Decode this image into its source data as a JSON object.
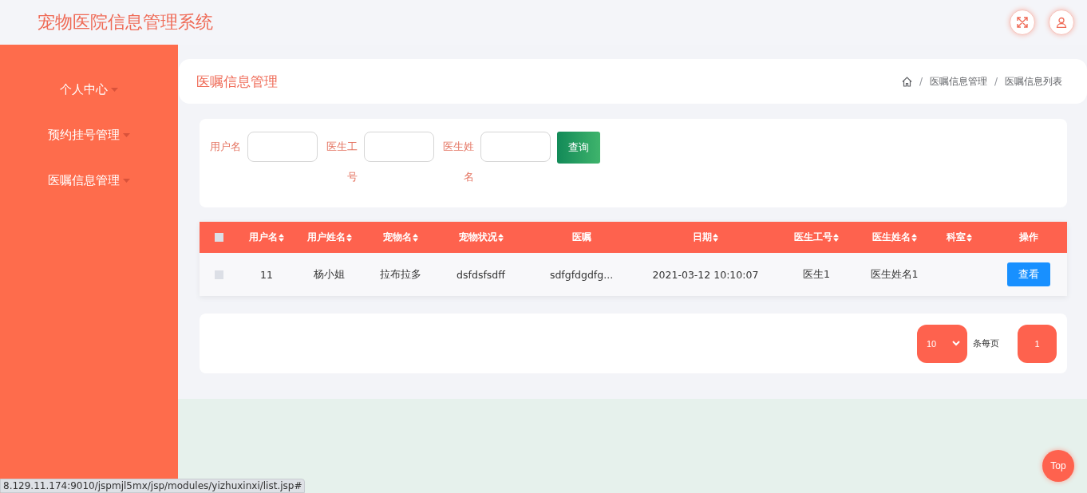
{
  "header": {
    "title": "宠物医院信息管理系统"
  },
  "sidebar": {
    "items": [
      {
        "label": "个人中心"
      },
      {
        "label": "预约挂号管理"
      },
      {
        "label": "医嘱信息管理"
      }
    ]
  },
  "page_title": "医嘱信息管理",
  "breadcrumb": {
    "separator": "/",
    "items": [
      "医嘱信息管理",
      "医嘱信息列表"
    ]
  },
  "search": {
    "fields": [
      {
        "label": "用户名"
      },
      {
        "label": "医生工号"
      },
      {
        "label": "医生姓名"
      }
    ],
    "button": "查询"
  },
  "table": {
    "select_all": {
      "checked": false
    },
    "columns": [
      {
        "label": "用户名",
        "sortable": true
      },
      {
        "label": "用户姓名",
        "sortable": true
      },
      {
        "label": "宠物名",
        "sortable": true
      },
      {
        "label": "宠物状况",
        "sortable": true
      },
      {
        "label": "医嘱",
        "sortable": false
      },
      {
        "label": "日期",
        "sortable": true
      },
      {
        "label": "医生工号",
        "sortable": true
      },
      {
        "label": "医生姓名",
        "sortable": true
      },
      {
        "label": "科室",
        "sortable": true
      },
      {
        "label": "操作",
        "sortable": false
      }
    ],
    "rows": [
      {
        "checked": false,
        "cells": [
          "11",
          "杨小姐",
          "拉布拉多",
          "dsfdsfsdff",
          "sdfgfdgdfg...",
          "2021-03-12 10:10:07",
          "医生1",
          "医生姓名1",
          ""
        ],
        "action": "查看"
      }
    ]
  },
  "pagination": {
    "page_size": "10",
    "page_size_suffix": "条每页",
    "pages": [
      {
        "label": "1",
        "selected": true
      }
    ]
  },
  "top_button": "Top",
  "status_bar": "8.129.11.174:9010/jspmjl5mx/jsp/modules/yizhuxinxi/list.jsp#"
}
